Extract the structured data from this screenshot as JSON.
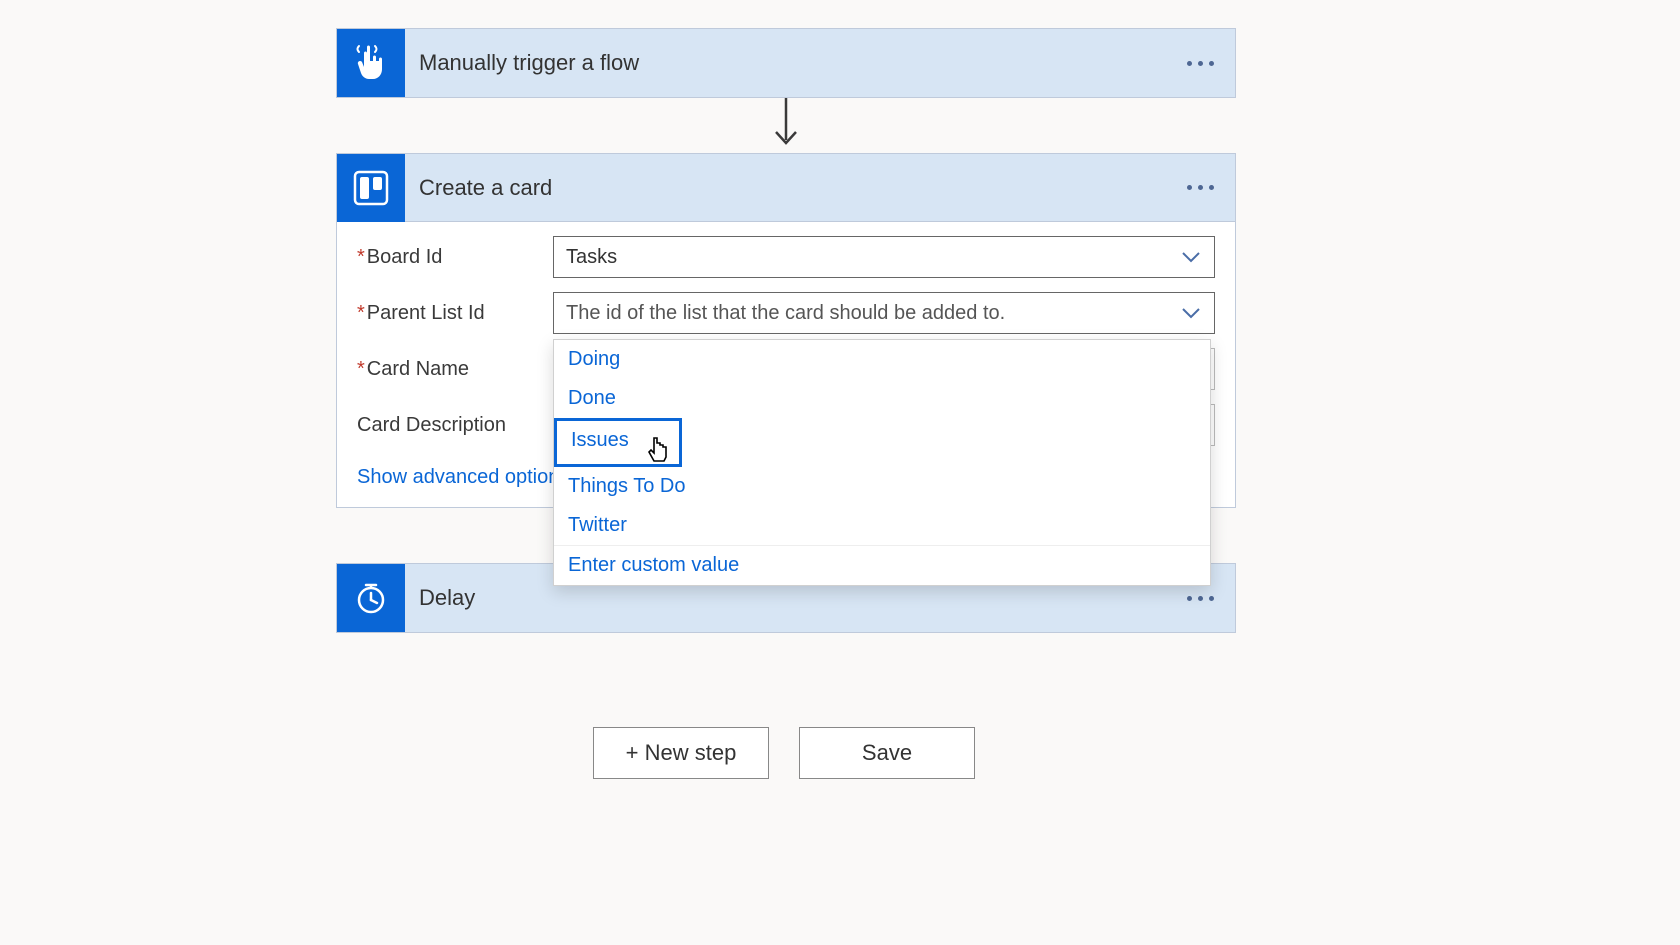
{
  "colors": {
    "headerBg": "#d7e5f4",
    "iconBg": "#0a66d6",
    "link": "#0a66d6"
  },
  "trigger": {
    "title": "Manually trigger a flow"
  },
  "createCard": {
    "title": "Create a card",
    "fields": {
      "boardId": {
        "label": "Board Id",
        "required": true,
        "value": "Tasks"
      },
      "parentListId": {
        "label": "Parent List Id",
        "required": true,
        "placeholder": "The id of the list that the card should be added to."
      },
      "cardName": {
        "label": "Card Name",
        "required": true
      },
      "cardDescription": {
        "label": "Card Description",
        "required": false
      }
    },
    "advanced": "Show advanced options"
  },
  "dropdown": {
    "options": [
      "Doing",
      "Done",
      "Issues",
      "Things To Do",
      "Twitter",
      "Enter custom value"
    ],
    "highlightedIndex": 2
  },
  "delay": {
    "title": "Delay"
  },
  "footer": {
    "newStep": "+ New step",
    "save": "Save"
  }
}
